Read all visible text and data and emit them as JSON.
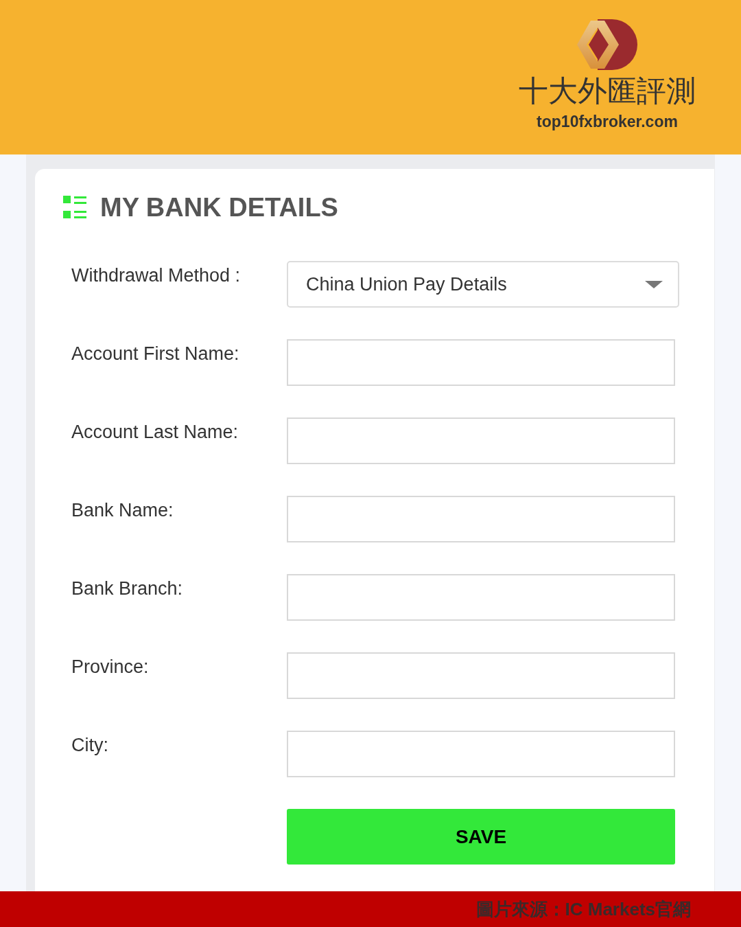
{
  "header": {
    "logo_text": "十大外匯評測",
    "site_url": "top10fxbroker.com"
  },
  "panel": {
    "title": "MY BANK DETAILS"
  },
  "form": {
    "fields": [
      {
        "kind": "select",
        "label": "Withdrawal Method :",
        "value": "China Union Pay Details"
      },
      {
        "kind": "text",
        "label": "Account First Name:"
      },
      {
        "kind": "text",
        "label": "Account Last Name:"
      },
      {
        "kind": "text",
        "label": "Bank Name:"
      },
      {
        "kind": "text",
        "label": "Bank Branch:"
      },
      {
        "kind": "text",
        "label": "Province:"
      },
      {
        "kind": "text",
        "label": "City:"
      }
    ],
    "save_button": "SAVE"
  },
  "footer": {
    "caption": "圖片來源：IC Markets官網"
  }
}
